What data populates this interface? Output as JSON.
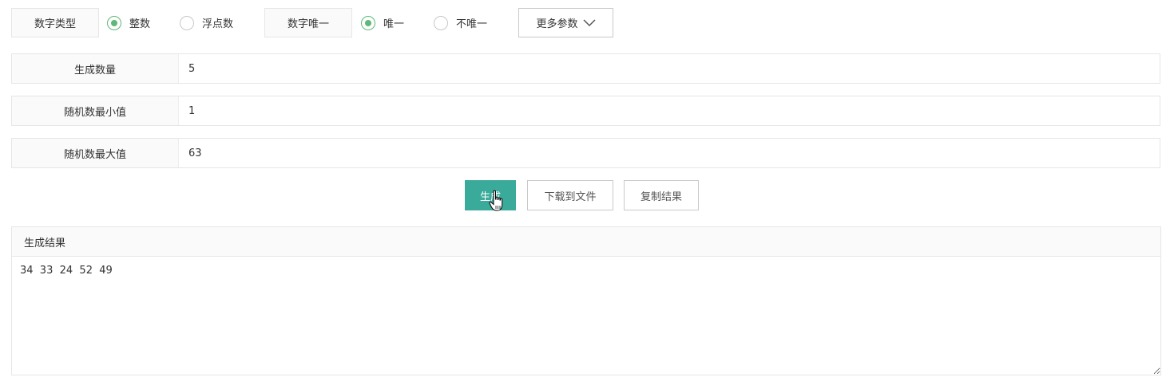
{
  "options": {
    "number_type_label": "数字类型",
    "number_type_options": [
      {
        "label": "整数",
        "checked": true
      },
      {
        "label": "浮点数",
        "checked": false
      }
    ],
    "unique_label": "数字唯一",
    "unique_options": [
      {
        "label": "唯一",
        "checked": true
      },
      {
        "label": "不唯一",
        "checked": false
      }
    ],
    "more_params_label": "更多参数",
    "more_params_icon": "chevron-down-icon"
  },
  "fields": {
    "count_label": "生成数量",
    "count_value": "5",
    "min_label": "随机数最小值",
    "min_value": "1",
    "max_label": "随机数最大值",
    "max_value": "63"
  },
  "actions": {
    "generate_label": "生成",
    "download_label": "下载到文件",
    "copy_label": "复制结果"
  },
  "result": {
    "header": "生成结果",
    "text": "34  33  24  52  49"
  },
  "colors": {
    "accent": "#3aaa9a",
    "radio_checked": "#5fb878"
  }
}
